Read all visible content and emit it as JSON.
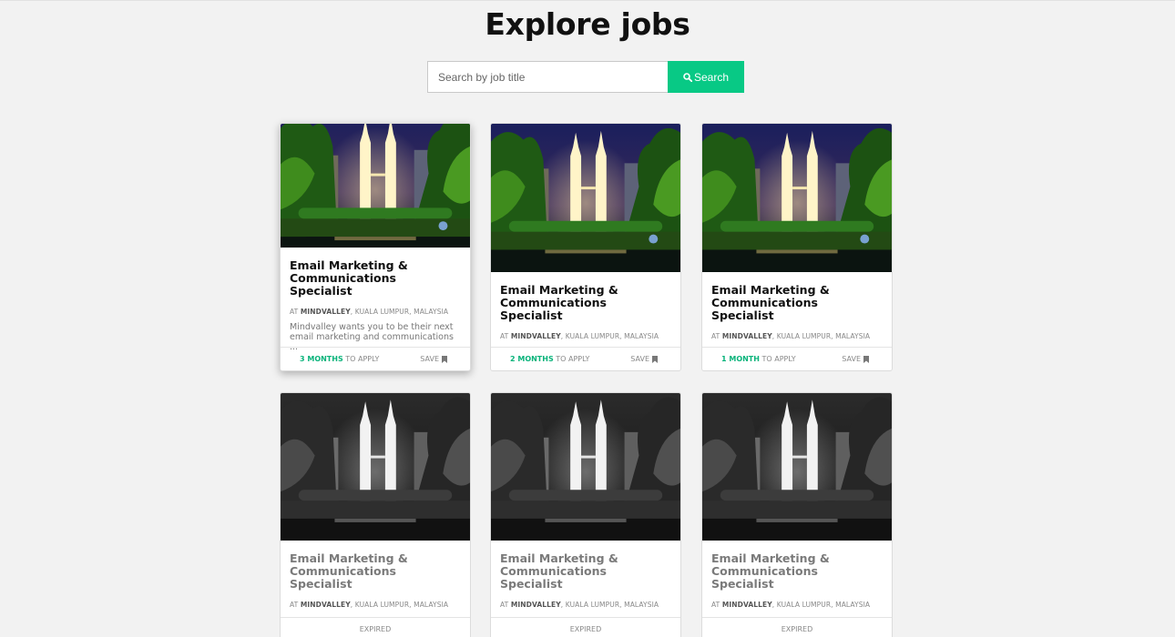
{
  "page": {
    "title": "Explore jobs"
  },
  "search": {
    "placeholder": "Search by job title",
    "button_label": "Search"
  },
  "colors": {
    "accent": "#08c985",
    "background": "#f2f2f2"
  },
  "jobs": [
    {
      "title": "Email Marketing & Communications Specialist",
      "at": "AT",
      "company": "MINDVALLEY",
      "location": ", KUALA LUMPUR, MALAYSIA",
      "description": "Mindvalley wants you to be their next email marketing and communications ...",
      "apply_count": "3 MONTHS",
      "apply_suffix": " TO APPLY",
      "save_label": "SAVE",
      "status": "active"
    },
    {
      "title": "Email Marketing & Communications Specialist",
      "at": "AT",
      "company": "MINDVALLEY",
      "location": ", KUALA LUMPUR, MALAYSIA",
      "apply_count": "2 MONTHS",
      "apply_suffix": " TO APPLY",
      "save_label": "SAVE",
      "status": "active"
    },
    {
      "title": "Email Marketing & Communications Specialist",
      "at": "AT",
      "company": "MINDVALLEY",
      "location": ", KUALA LUMPUR, MALAYSIA",
      "apply_count": "1 MONTH",
      "apply_suffix": " TO APPLY",
      "save_label": "SAVE",
      "status": "active"
    },
    {
      "title": "Email Marketing & Communications Specialist",
      "at": "AT",
      "company": "MINDVALLEY",
      "location": ", KUALA LUMPUR, MALAYSIA",
      "status_label": "EXPIRED",
      "status": "expired"
    },
    {
      "title": "Email Marketing & Communications Specialist",
      "at": "AT",
      "company": "MINDVALLEY",
      "location": ", KUALA LUMPUR, MALAYSIA",
      "status_label": "EXPIRED",
      "status": "expired"
    },
    {
      "title": "Email Marketing & Communications Specialist",
      "at": "AT",
      "company": "MINDVALLEY",
      "location": ", KUALA LUMPUR, MALAYSIA",
      "status_label": "EXPIRED",
      "status": "expired"
    }
  ]
}
